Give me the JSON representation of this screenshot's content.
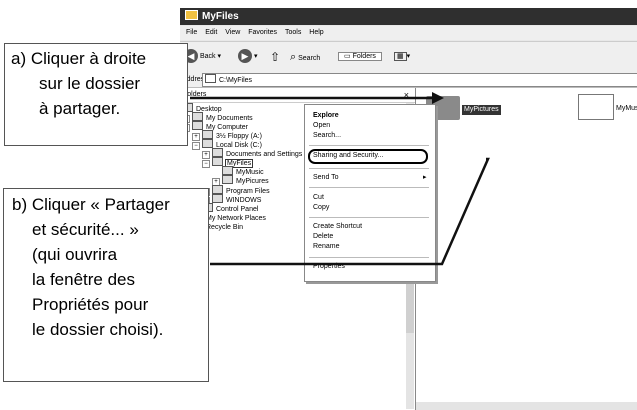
{
  "window": {
    "title": "MyFiles"
  },
  "menubar": [
    "File",
    "Edit",
    "View",
    "Favorites",
    "Tools",
    "Help"
  ],
  "toolbar": {
    "back": "Back",
    "search": "Search",
    "folders": "Folders"
  },
  "address": {
    "label": "Address",
    "value": "C:\\MyFiles"
  },
  "tree": {
    "header": "Folders",
    "close": "×",
    "items": [
      "Desktop",
      "My Documents",
      "My Computer",
      "3½ Floppy (A:)",
      "Local Disk (C:)",
      "Documents and Settings",
      "MyFiles",
      "MyMusic",
      "MyPicures",
      "Program Files",
      "WINDOWS",
      "Control Panel",
      "My Network Places",
      "Recycle Bin"
    ]
  },
  "content": {
    "folder1": "MyPictures",
    "folder2": "MyMusi"
  },
  "context_menu": {
    "items": [
      "Explore",
      "Open",
      "Search...",
      "Sharing and Security...",
      "Send To",
      "Cut",
      "Copy",
      "Create Shortcut",
      "Delete",
      "Rename",
      "Properties"
    ]
  },
  "callout_a": {
    "lines": [
      "a) Cliquer à droite",
      "sur le dossier",
      "à partager."
    ]
  },
  "callout_b": {
    "lines": [
      "b) Cliquer « Partager",
      "et sécurité... »",
      "(qui ouvrira",
      "la fenêtre des",
      "Propriétés pour",
      "le dossier choisi)."
    ]
  }
}
